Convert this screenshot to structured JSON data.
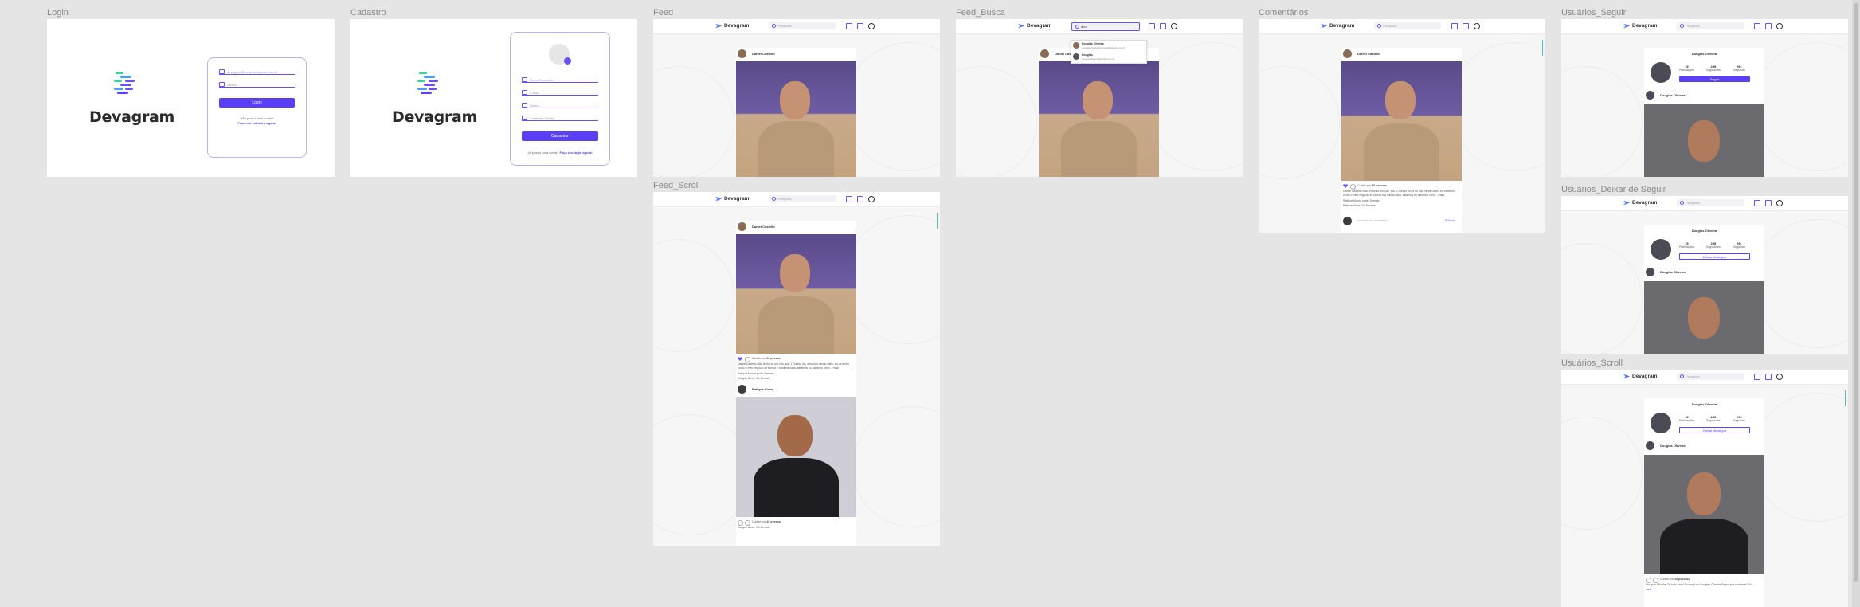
{
  "frames": {
    "login": "Login",
    "cadastro": "Cadastro",
    "feed": "Feed",
    "feed_busca": "Feed_Busca",
    "comentarios": "Comentários",
    "usuarios_seguir": "Usuários_Seguir",
    "feed_scroll": "Feed_Scroll",
    "usuarios_deixar": "Usuários_Deixar de Seguir",
    "usuarios_scroll": "Usuários_Scroll"
  },
  "brand": "Devagram",
  "login": {
    "email_placeholder": "devagram@compartilhapost.com.br",
    "password_placeholder": "Senha",
    "button": "Login",
    "no_account": "Não possui uma conta?",
    "signup_link": "Faça seu cadastro agora!"
  },
  "cadastro": {
    "name_placeholder": "Nome Completo",
    "email_placeholder": "E-mail",
    "password_placeholder": "Senha",
    "confirm_placeholder": "Confirmar Senha",
    "button": "Cadastrar",
    "has_account": "Já possui uma conta?",
    "login_link": "Faça seu login agora!"
  },
  "topbar": {
    "search_placeholder": "Pesquisar",
    "search_typed": "dou"
  },
  "search_results": [
    {
      "name": "Douglas Oliveira",
      "email": "douglasoliveira@compartilhapost.com.br"
    },
    {
      "name": "Douglas",
      "email": "compartilhapost@gmail.com.br"
    }
  ],
  "posts": {
    "author1": "Daniel Castello",
    "author2": "Rafique Alves",
    "likes_text": "Curtido por",
    "likes_count": "35 pessoas",
    "caption1": "Daniel Castello Não tenho só um cão, sou 1 Sonho! Ah, e eu não vendo cães, eu os tenho como o meu negócio se tornou e a minha casa, estamos no caminho certo... mais",
    "comment1": "Rafique Moura pode: Demais",
    "comment2": "Rafique Alves: Só Demais",
    "more": "mais",
    "comment_placeholder": "Adicione um comentário...",
    "publish": "Publicar"
  },
  "profile": {
    "name": "Douglas Oliveira",
    "publicacoes_count": "15",
    "publicacoes_label": "Publicações",
    "seguindo_count": "285",
    "seguindo_label": "Seguidores",
    "seguidores_count": "291",
    "seguidores_label": "Seguindo",
    "follow_button": "Seguir",
    "unfollow_button": "Deixar de seguir",
    "post_author": "Douglas Oliveira",
    "caption": "Douglas Oliveira Oi, tudo bem! Sou aqui no Douglas Oliveira Segue pra conhecer! Só..."
  },
  "colors": {
    "accent": "#5b3ff6",
    "canvas": "#e5e5e5",
    "teal": "#46c6c0"
  }
}
